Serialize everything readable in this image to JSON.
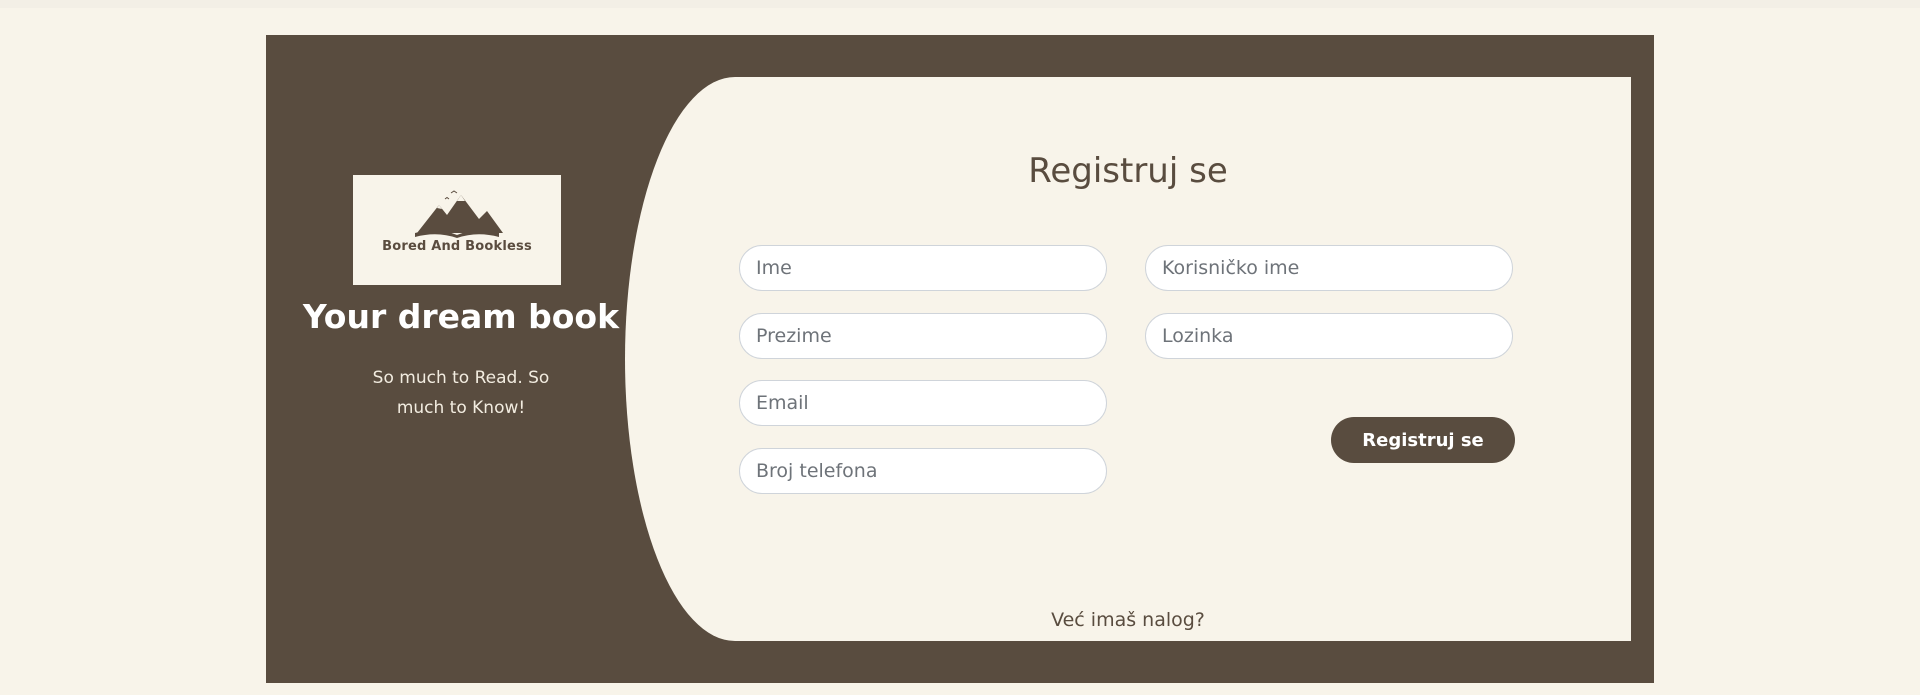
{
  "brand": {
    "logo_text": "Bored And Bookless",
    "tagline": "Your dream book",
    "subtitle": "So much to Read. So much to Know!"
  },
  "form": {
    "title": "Registruj se",
    "fields": {
      "first_name": {
        "placeholder": "Ime",
        "value": ""
      },
      "last_name": {
        "placeholder": "Prezime",
        "value": ""
      },
      "email": {
        "placeholder": "Email",
        "value": ""
      },
      "phone": {
        "placeholder": "Broj telefona",
        "value": ""
      },
      "username": {
        "placeholder": "Korisničko ime",
        "value": ""
      },
      "password": {
        "placeholder": "Lozinka",
        "value": ""
      }
    },
    "submit_label": "Registruj se",
    "login_link": "Već imaš nalog?"
  },
  "colors": {
    "background": "#f8f4ea",
    "brand_brown": "#594c3f",
    "field_border": "#cfd4da"
  }
}
